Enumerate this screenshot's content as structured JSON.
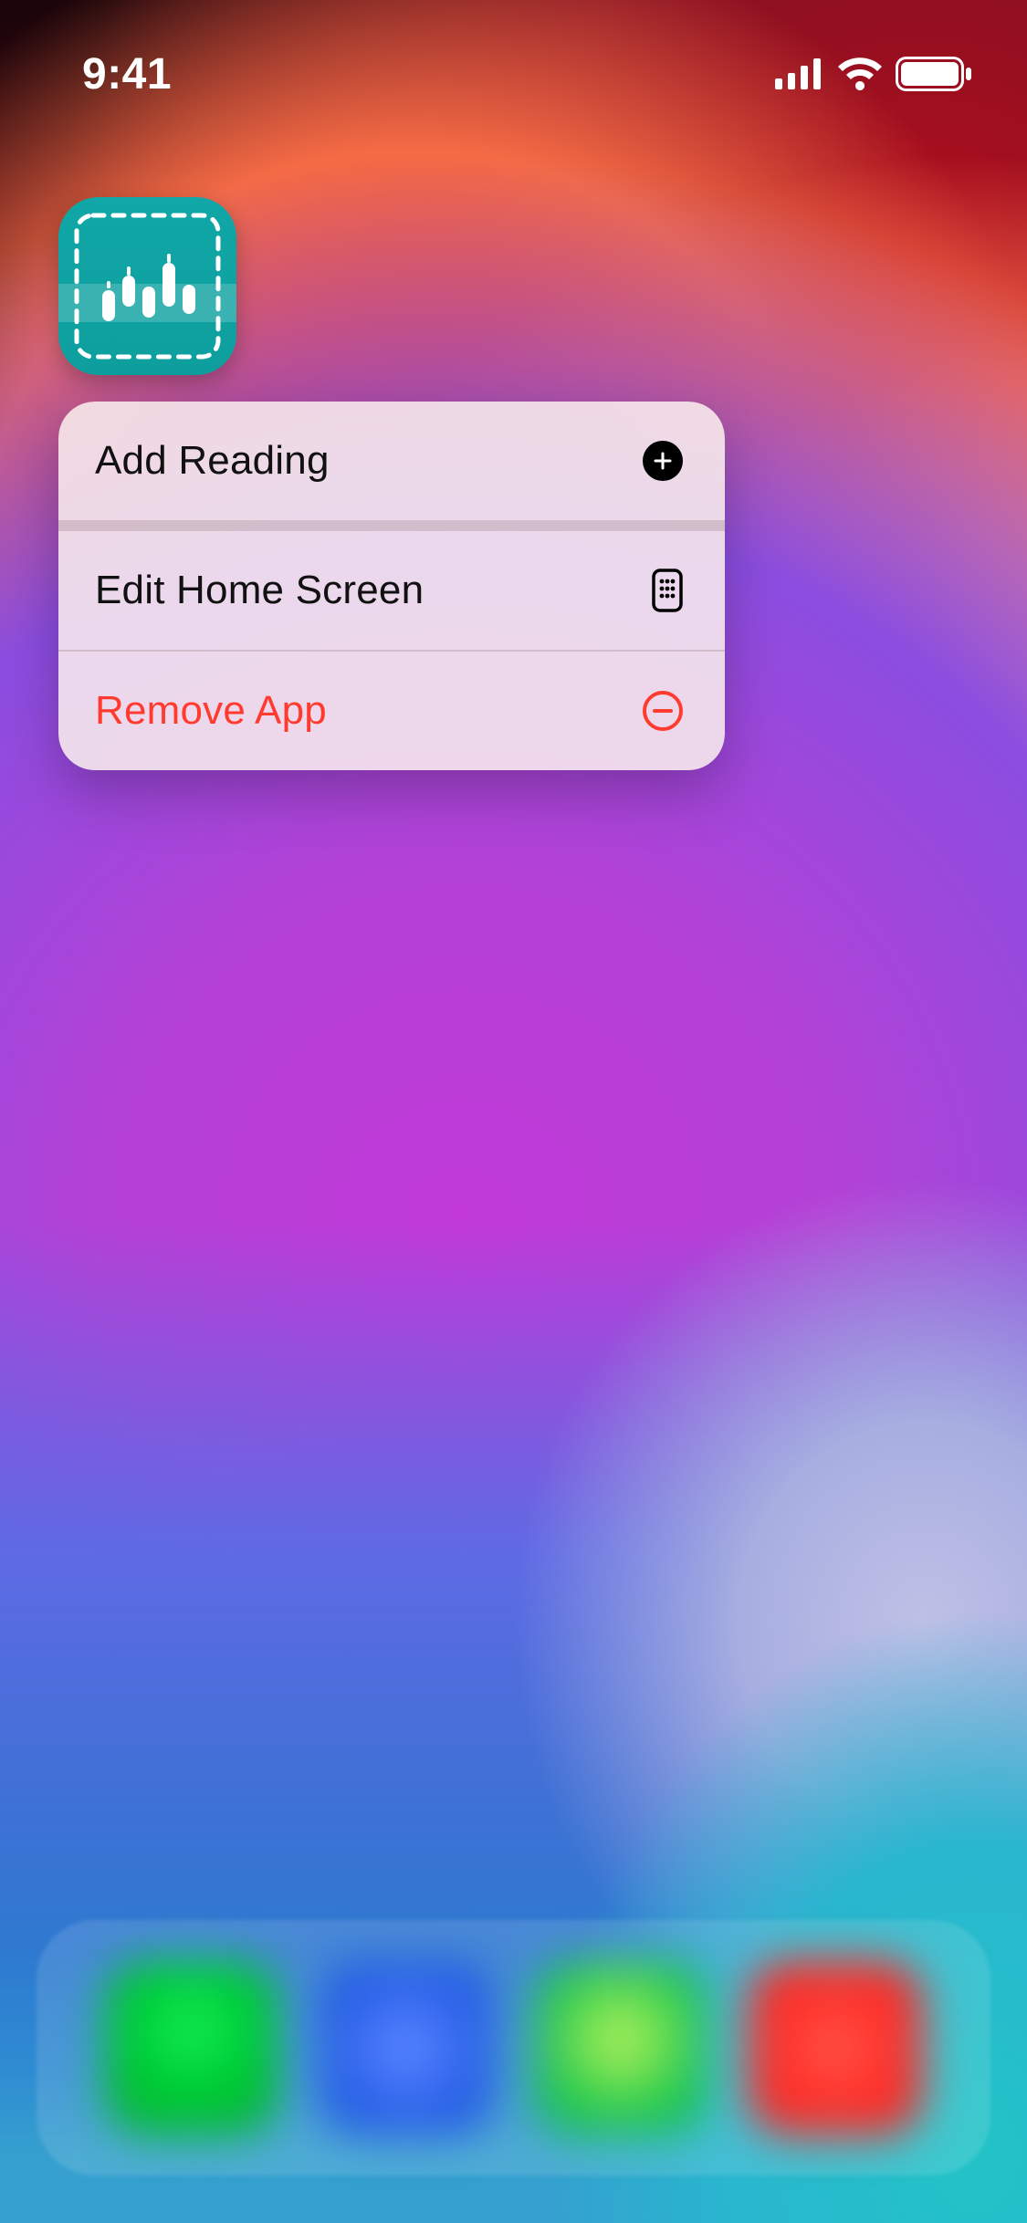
{
  "status": {
    "time": "9:41"
  },
  "app": {
    "name": "reading-tracker-app"
  },
  "menu": {
    "items": [
      {
        "label": "Add Reading",
        "icon": "plus-circle-icon",
        "destructive": false
      },
      {
        "label": "Edit Home Screen",
        "icon": "apps-grid-icon",
        "destructive": false
      },
      {
        "label": "Remove App",
        "icon": "minus-circle-icon",
        "destructive": true
      }
    ]
  },
  "colors": {
    "destructive": "#ff3b30",
    "app_icon_bg": "#11a7a7"
  }
}
